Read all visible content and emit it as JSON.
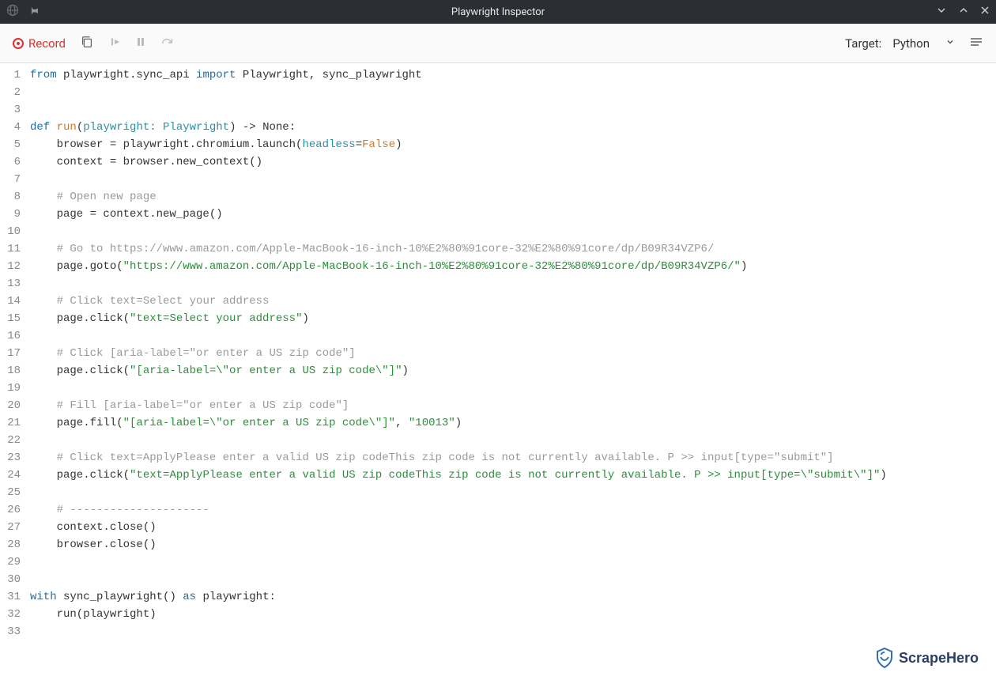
{
  "title": "Playwright Inspector",
  "toolbar": {
    "record_label": "Record",
    "target_label": "Target:",
    "target_value": "Python"
  },
  "code": {
    "lines": [
      {
        "n": 1,
        "segments": [
          {
            "t": "from ",
            "c": "tok-kw"
          },
          {
            "t": "playwright.sync_api ",
            "c": ""
          },
          {
            "t": "import ",
            "c": "tok-kw"
          },
          {
            "t": "Playwright, sync_playwright",
            "c": ""
          }
        ]
      },
      {
        "n": 2,
        "segments": []
      },
      {
        "n": 3,
        "segments": []
      },
      {
        "n": 4,
        "segments": [
          {
            "t": "def ",
            "c": "tok-def"
          },
          {
            "t": "run",
            "c": "tok-fn"
          },
          {
            "t": "(",
            "c": ""
          },
          {
            "t": "playwright: Playwright",
            "c": "tok-type"
          },
          {
            "t": ") -> None:",
            "c": ""
          }
        ]
      },
      {
        "n": 5,
        "segments": [
          {
            "t": "    browser = playwright.chromium.launch(",
            "c": ""
          },
          {
            "t": "headless",
            "c": "tok-type"
          },
          {
            "t": "=",
            "c": ""
          },
          {
            "t": "False",
            "c": "tok-const"
          },
          {
            "t": ")",
            "c": ""
          }
        ]
      },
      {
        "n": 6,
        "segments": [
          {
            "t": "    context = browser.new_context()",
            "c": ""
          }
        ]
      },
      {
        "n": 7,
        "segments": []
      },
      {
        "n": 8,
        "segments": [
          {
            "t": "    ",
            "c": ""
          },
          {
            "t": "# Open new page",
            "c": "tok-comment"
          }
        ]
      },
      {
        "n": 9,
        "segments": [
          {
            "t": "    page = context.new_page()",
            "c": ""
          }
        ]
      },
      {
        "n": 10,
        "segments": []
      },
      {
        "n": 11,
        "segments": [
          {
            "t": "    ",
            "c": ""
          },
          {
            "t": "# Go to https://www.amazon.com/Apple-MacBook-16-inch-10%E2%80%91core-32%E2%80%91core/dp/B09R34VZP6/",
            "c": "tok-comment"
          }
        ]
      },
      {
        "n": 12,
        "segments": [
          {
            "t": "    page.goto(",
            "c": ""
          },
          {
            "t": "\"https://www.amazon.com/Apple-MacBook-16-inch-10%E2%80%91core-32%E2%80%91core/dp/B09R34VZP6/\"",
            "c": "tok-str"
          },
          {
            "t": ")",
            "c": ""
          }
        ]
      },
      {
        "n": 13,
        "segments": []
      },
      {
        "n": 14,
        "segments": [
          {
            "t": "    ",
            "c": ""
          },
          {
            "t": "# Click text=Select your address",
            "c": "tok-comment"
          }
        ]
      },
      {
        "n": 15,
        "segments": [
          {
            "t": "    page.click(",
            "c": ""
          },
          {
            "t": "\"text=Select your address\"",
            "c": "tok-str"
          },
          {
            "t": ")",
            "c": ""
          }
        ]
      },
      {
        "n": 16,
        "segments": []
      },
      {
        "n": 17,
        "segments": [
          {
            "t": "    ",
            "c": ""
          },
          {
            "t": "# Click [aria-label=\"or enter a US zip code\"]",
            "c": "tok-comment"
          }
        ]
      },
      {
        "n": 18,
        "segments": [
          {
            "t": "    page.click(",
            "c": ""
          },
          {
            "t": "\"[aria-label=\\\"or enter a US zip code\\\"]\"",
            "c": "tok-str"
          },
          {
            "t": ")",
            "c": ""
          }
        ]
      },
      {
        "n": 19,
        "segments": []
      },
      {
        "n": 20,
        "segments": [
          {
            "t": "    ",
            "c": ""
          },
          {
            "t": "# Fill [aria-label=\"or enter a US zip code\"]",
            "c": "tok-comment"
          }
        ]
      },
      {
        "n": 21,
        "segments": [
          {
            "t": "    page.fill(",
            "c": ""
          },
          {
            "t": "\"[aria-label=\\\"or enter a US zip code\\\"]\"",
            "c": "tok-str"
          },
          {
            "t": ", ",
            "c": ""
          },
          {
            "t": "\"10013\"",
            "c": "tok-str"
          },
          {
            "t": ")",
            "c": ""
          }
        ]
      },
      {
        "n": 22,
        "segments": []
      },
      {
        "n": 23,
        "segments": [
          {
            "t": "    ",
            "c": ""
          },
          {
            "t": "# Click text=ApplyPlease enter a valid US zip codeThis zip code is not currently available. P >> input[type=\"submit\"]",
            "c": "tok-comment"
          }
        ]
      },
      {
        "n": 24,
        "segments": [
          {
            "t": "    page.click(",
            "c": ""
          },
          {
            "t": "\"text=ApplyPlease enter a valid US zip codeThis zip code is not currently available. P >> input[type=\\\"submit\\\"]\"",
            "c": "tok-str"
          },
          {
            "t": ")",
            "c": ""
          }
        ]
      },
      {
        "n": 25,
        "segments": []
      },
      {
        "n": 26,
        "segments": [
          {
            "t": "    ",
            "c": ""
          },
          {
            "t": "# ---------------------",
            "c": "tok-comment"
          }
        ]
      },
      {
        "n": 27,
        "segments": [
          {
            "t": "    context.close()",
            "c": ""
          }
        ]
      },
      {
        "n": 28,
        "segments": [
          {
            "t": "    browser.close()",
            "c": ""
          }
        ]
      },
      {
        "n": 29,
        "segments": []
      },
      {
        "n": 30,
        "segments": []
      },
      {
        "n": 31,
        "segments": [
          {
            "t": "with ",
            "c": "tok-kw"
          },
          {
            "t": "sync_playwright() ",
            "c": ""
          },
          {
            "t": "as ",
            "c": "tok-kw"
          },
          {
            "t": "playwright:",
            "c": ""
          }
        ]
      },
      {
        "n": 32,
        "segments": [
          {
            "t": "    run(playwright)",
            "c": ""
          }
        ]
      },
      {
        "n": 33,
        "segments": []
      }
    ]
  },
  "logo_text": "ScrapeHero"
}
